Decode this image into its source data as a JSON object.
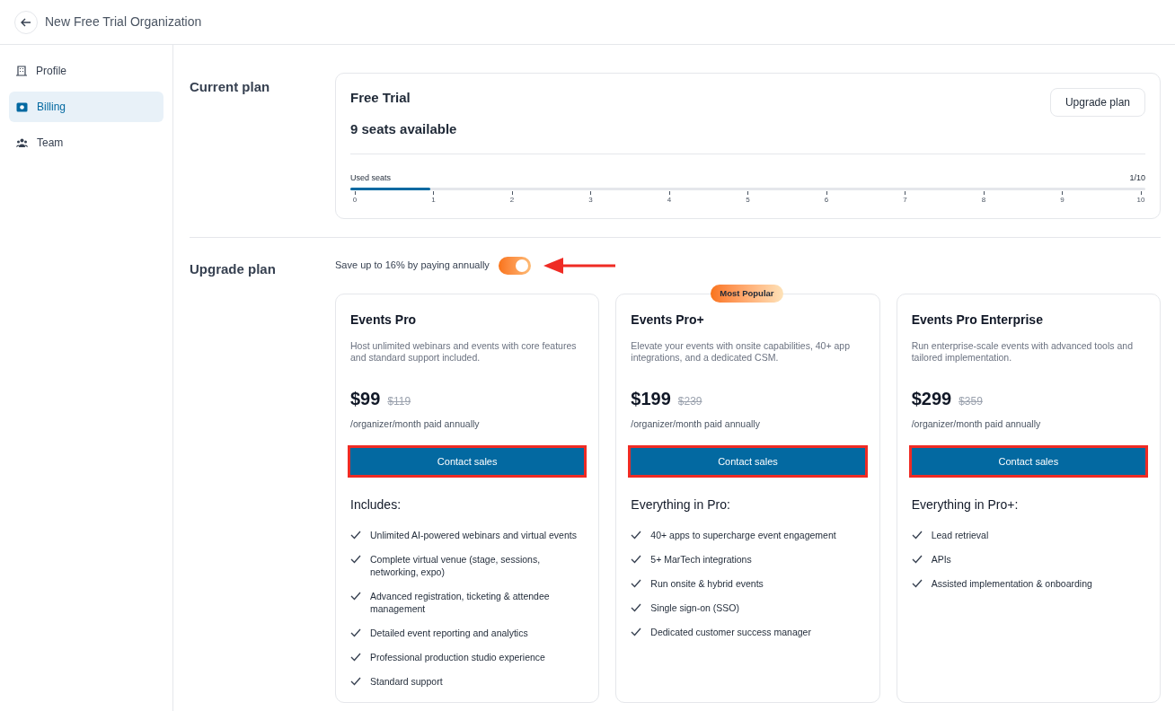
{
  "header": {
    "title": "New Free Trial Organization"
  },
  "sidebar": {
    "items": [
      {
        "label": "Profile",
        "kind": "building",
        "selected": false
      },
      {
        "label": "Billing",
        "kind": "billing",
        "selected": true
      },
      {
        "label": "Team",
        "kind": "team",
        "selected": false
      }
    ]
  },
  "current_plan": {
    "heading": "Current plan",
    "plan_name": "Free Trial",
    "seats": "9 seats available",
    "upgrade_button": "Upgrade plan",
    "meter": {
      "label": "Used seats",
      "reading": "1/10",
      "level": 0.1,
      "ticks": [
        "0",
        "1",
        "2",
        "3",
        "4",
        "5",
        "6",
        "7",
        "8",
        "9",
        "10"
      ]
    }
  },
  "upgrade": {
    "heading": "Upgrade plan",
    "toggle_label": "Save up to 16% by paying annually",
    "annual_on": true,
    "arrow_annotation": true,
    "plans": [
      {
        "name": "Events Pro",
        "description": "Host unlimited webinars and events with core features and standard support included.",
        "price": "$99",
        "old_price": "$119",
        "period": "/organizer/month paid annually",
        "button": "Contact sales",
        "highlighted": true,
        "features_heading": "Includes:",
        "features": [
          "Unlimited AI-powered webinars and virtual events",
          "Complete virtual venue (stage, sessions, networking, expo)",
          "Advanced registration, ticketing & attendee management",
          "Detailed event reporting and analytics",
          "Professional production studio experience",
          "Standard support"
        ]
      },
      {
        "name": "Events Pro+",
        "badge": "Most Popular",
        "description": "Elevate your events with onsite capabilities, 40+ app integrations, and a dedicated CSM.",
        "price": "$199",
        "old_price": "$239",
        "period": "/organizer/month paid annually",
        "button": "Contact sales",
        "highlighted": true,
        "features_heading": "Everything in Pro:",
        "features": [
          "40+ apps to supercharge event engagement",
          "5+ MarTech integrations",
          "Run onsite & hybrid events",
          "Single sign-on (SSO)",
          "Dedicated customer success manager"
        ]
      },
      {
        "name": "Events Pro Enterprise",
        "description": "Run enterprise-scale events with advanced tools and tailored implementation.",
        "price": "$299",
        "old_price": "$359",
        "period": "/organizer/month paid annually",
        "button": "Contact sales",
        "highlighted": true,
        "features_heading": "Everything in Pro+:",
        "features": [
          "Lead retrieval",
          "APIs",
          "Assisted implementation & onboarding"
        ]
      }
    ]
  }
}
